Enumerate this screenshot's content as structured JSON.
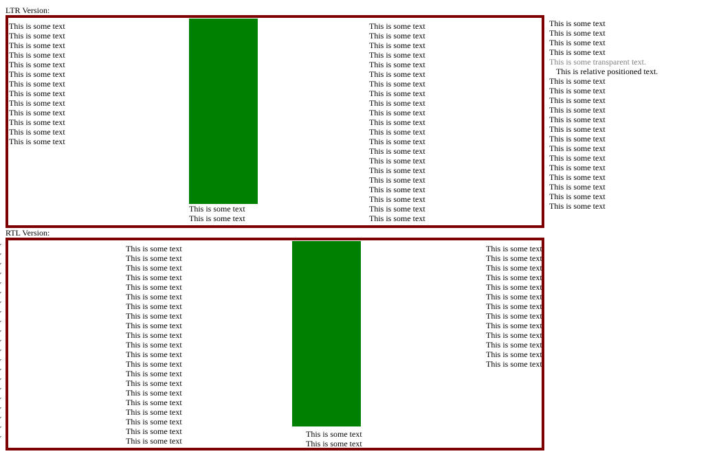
{
  "ltr": {
    "label": "LTR Version:",
    "col1": [
      "This is some text",
      "This is some text",
      "This is some text",
      "This is some text",
      "This is some text",
      "This is some text",
      "This is some text",
      "This is some text",
      "This is some text",
      "This is some text",
      "This is some text",
      "This is some text",
      "This is some text"
    ],
    "under_green": [
      "This is some text",
      "This is some text"
    ],
    "col3": [
      "This is some text",
      "This is some text",
      "This is some text",
      "This is some text",
      "This is some text",
      "This is some text",
      "This is some text",
      "This is some text",
      "This is some text",
      "This is some text",
      "This is some text",
      "This is some text",
      "This is some text",
      "This is some text",
      "This is some text",
      "This is some text",
      "This is some text",
      "This is some text",
      "This is some text",
      "This is some text",
      "This is some text"
    ],
    "outside": {
      "before": [
        "This is some text",
        "This is some text",
        "This is some text",
        "This is some text"
      ],
      "transparent": "This is some transparent text.",
      "relative": "This is relative positioned text.",
      "after": [
        "This is some text",
        "This is some text",
        "This is some text",
        "This is some text",
        "This is some text",
        "This is some text",
        "This is some text",
        "This is some text",
        "This is some text",
        "This is some text",
        "This is some text",
        "This is some text",
        "This is some text",
        "This is some text"
      ]
    }
  },
  "rtl": {
    "label": "RTL Version:",
    "col1": [
      "This is some text",
      "This is some text",
      "This is some text",
      "This is some text",
      "This is some text",
      "This is some text",
      "This is some text",
      "This is some text",
      "This is some text",
      "This is some text",
      "This is some text",
      "This is some text",
      "This is some text",
      "This is some text",
      "This is some text",
      "This is some text",
      "This is some text",
      "This is some text",
      "This is some text",
      "This is some text",
      "This is some text"
    ],
    "under_green": [
      "This is some text",
      "This is some text"
    ],
    "col3": [
      "This is some text",
      "This is some text",
      "This is some text",
      "This is some text",
      "This is some text",
      "This is some text",
      "This is some text",
      "This is some text",
      "This is some text",
      "This is some text",
      "This is some text",
      "This is some text",
      "This is some text"
    ]
  },
  "colors": {
    "border": "#7f0000",
    "green_block": "#008000",
    "transparent_text": "#7f7f7f"
  }
}
